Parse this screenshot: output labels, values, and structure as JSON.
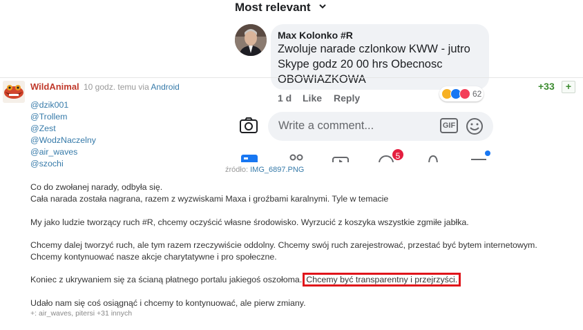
{
  "entry": {
    "author": "WildAnimal",
    "time": "10 godz. temu",
    "via_prefix": "via",
    "via_app": "Android",
    "votes": "+33",
    "vote_button": "+",
    "mentions": [
      "@dzik001",
      "@Trollem",
      "@Zest",
      "@WodzNaczelny",
      "@air_waves",
      "@szochi"
    ],
    "paragraphs": {
      "p1_line1": "Co do zwołanej narady, odbyła się.",
      "p1_line2": "Cała narada została nagrana, razem z wyzwiskami Maxa i groźbami karalnymi. Tyle w temacie",
      "p2": "My jako ludzie tworzący ruch #R, chcemy oczyścić własne środowisko. Wyrzucić z koszyka wszystkie zgmiłe jabłka.",
      "p3_line1": "Chcemy dalej tworzyć ruch, ale tym razem rzeczywiście oddolny. Chcemy swój ruch zarejestrować, przestać być bytem internetowym.",
      "p3_line2": "Chcemy kontynuować nasze akcje charytatywne i pro społeczne.",
      "p4_start": "Koniec z ukrywaniem się za ścianą płatnego portalu jakiegoś oszołoma.",
      "p4_highlight": "Chcemy być transparentny i przejrzyści.",
      "p5": "Udało nam się coś osiągnąć i chcemy to kontynuować, ale pierw zmiany."
    },
    "source_label": "źródło:",
    "source_file": "IMG_6897.PNG",
    "voters": "+: air_waves, pitersi +31 innych"
  },
  "fb": {
    "sort_label": "Most relevant",
    "comment_author": "Max Kolonko #R",
    "comment_lines": [
      "Zwoluje narade czlonkow KWW - jutro",
      "Skype godz 20 00 hrs Obecnosc",
      "OBOWIAZKOWA"
    ],
    "age": "1 d",
    "like": "Like",
    "reply": "Reply",
    "reaction_count": "62",
    "input_placeholder": "Write a comment...",
    "gif_label": "GIF",
    "notif_badge": "5"
  },
  "colors": {
    "author": "#c0392b",
    "link": "#367aa9",
    "vote": "#3b8b2f",
    "highlight_border": "#e0141a",
    "fb_bubble": "#f0f2f5",
    "fb_blue": "#1877f2"
  }
}
